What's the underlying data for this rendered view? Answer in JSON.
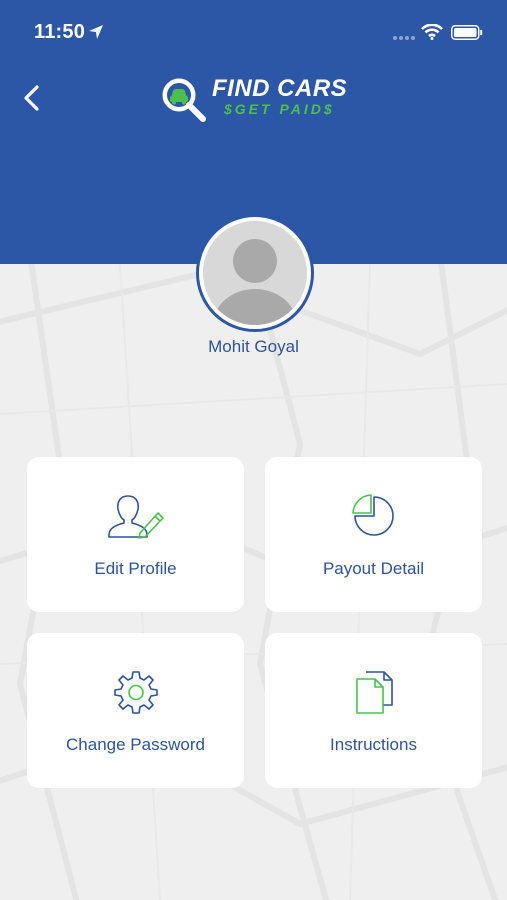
{
  "status_bar": {
    "time": "11:50",
    "icons": [
      "location-arrow-icon",
      "signal-dots-icon",
      "wifi-icon",
      "battery-icon"
    ]
  },
  "header": {
    "background": "#2b57a6",
    "back_icon": "chevron-left-icon",
    "logo": {
      "title": "FIND CARS",
      "subtitle": "$GET PAID$",
      "subtitle_color": "#4cc04f"
    }
  },
  "profile": {
    "name": "Mohit Goyal",
    "avatar_icon": "user-placeholder-avatar"
  },
  "menu": {
    "items": [
      {
        "label": "Edit Profile",
        "icon": "edit-user-icon"
      },
      {
        "label": "Payout Detail",
        "icon": "pie-chart-icon"
      },
      {
        "label": "Change Password",
        "icon": "gear-icon"
      },
      {
        "label": "Instructions",
        "icon": "documents-icon"
      }
    ],
    "text_color": "#2e5497",
    "icon_blue": "#2e5497",
    "icon_green": "#4cc04f"
  }
}
